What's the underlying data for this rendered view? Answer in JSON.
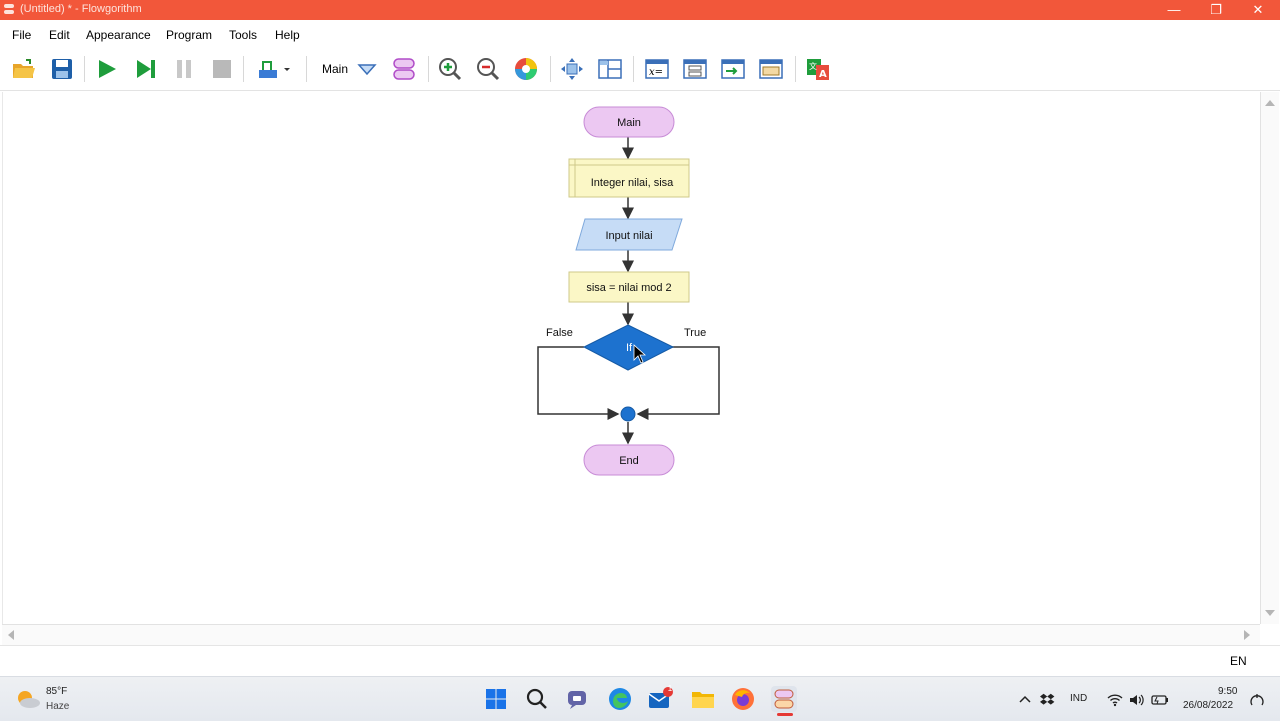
{
  "window": {
    "title": "(Untitled) * - Flowgorithm",
    "minimize_glyph": "—",
    "maximize_glyph": "❐",
    "close_glyph": "✕"
  },
  "menu": [
    "File",
    "Edit",
    "Appearance",
    "Program",
    "Tools",
    "Help"
  ],
  "toolbar": {
    "function_label": "Main",
    "icons": [
      "open-folder-icon",
      "save-icon",
      "run-icon",
      "step-icon",
      "pause-icon",
      "stop-icon",
      "speed-icon",
      "function-dropdown-icon",
      "manage-functions-icon",
      "zoom-in-icon",
      "zoom-out-icon",
      "color-scheme-icon",
      "fit-view-icon",
      "layout-icon",
      "variable-watch-icon",
      "flowchart-view-icon",
      "console-icon",
      "source-view-icon",
      "translate-icon"
    ]
  },
  "flowchart": {
    "start_label": "Main",
    "declare_label": "Integer nilai, sisa",
    "input_label": "Input nilai",
    "assign_label": "sisa = nilai mod 2",
    "if_label": "If",
    "false_label": "False",
    "true_label": "True",
    "end_label": "End",
    "colors": {
      "terminal": "#ecc8f2",
      "process": "#fbf7c6",
      "input": "#c6dcf6",
      "decision": "#1d72cf"
    }
  },
  "status": {
    "lang": "EN"
  },
  "taskbar": {
    "weather_temp": "85°F",
    "weather_desc": "Haze",
    "mail_badge": "1",
    "tray_lang": "IND",
    "time": "9:50",
    "date": "26/08/2022"
  }
}
